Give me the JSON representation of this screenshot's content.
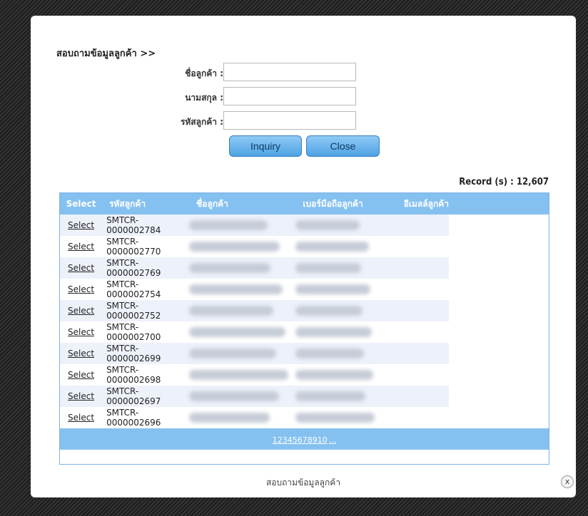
{
  "form": {
    "title": "สอบถามข้อมูลลูกค้า >>",
    "fields": [
      {
        "label": "ชื่อลูกค้า :",
        "value": ""
      },
      {
        "label": "นามสกุล :",
        "value": ""
      },
      {
        "label": "รหัสลูกค้า :",
        "value": ""
      }
    ],
    "inquiry_label": "Inquiry",
    "close_label": "Close"
  },
  "record_text": "Record (s) : 12,607",
  "table": {
    "columns": [
      "Select",
      "รหัสลูกค้า",
      "ชื่อลูกค้า",
      "เบอร์มือถือลูกค้า",
      "อีเมลล์ลูกค้า"
    ],
    "select_label": "Select",
    "rows": [
      {
        "code": "SMTCR-0000002784"
      },
      {
        "code": "SMTCR-0000002770"
      },
      {
        "code": "SMTCR-0000002769"
      },
      {
        "code": "SMTCR-0000002754"
      },
      {
        "code": "SMTCR-0000002752"
      },
      {
        "code": "SMTCR-0000002700"
      },
      {
        "code": "SMTCR-0000002699"
      },
      {
        "code": "SMTCR-0000002698"
      },
      {
        "code": "SMTCR-0000002697"
      },
      {
        "code": "SMTCR-0000002696"
      }
    ]
  },
  "pager": [
    "1",
    "2",
    "3",
    "4",
    "5",
    "6",
    "7",
    "8",
    "9",
    "10",
    "..."
  ],
  "footer_caption": "สอบถามข้อมูลลูกค้า",
  "close_icon_glyph": "x",
  "colors": {
    "header": "#85c1f0",
    "alt_row": "#edf1fa",
    "button": "#4ea3e3"
  }
}
